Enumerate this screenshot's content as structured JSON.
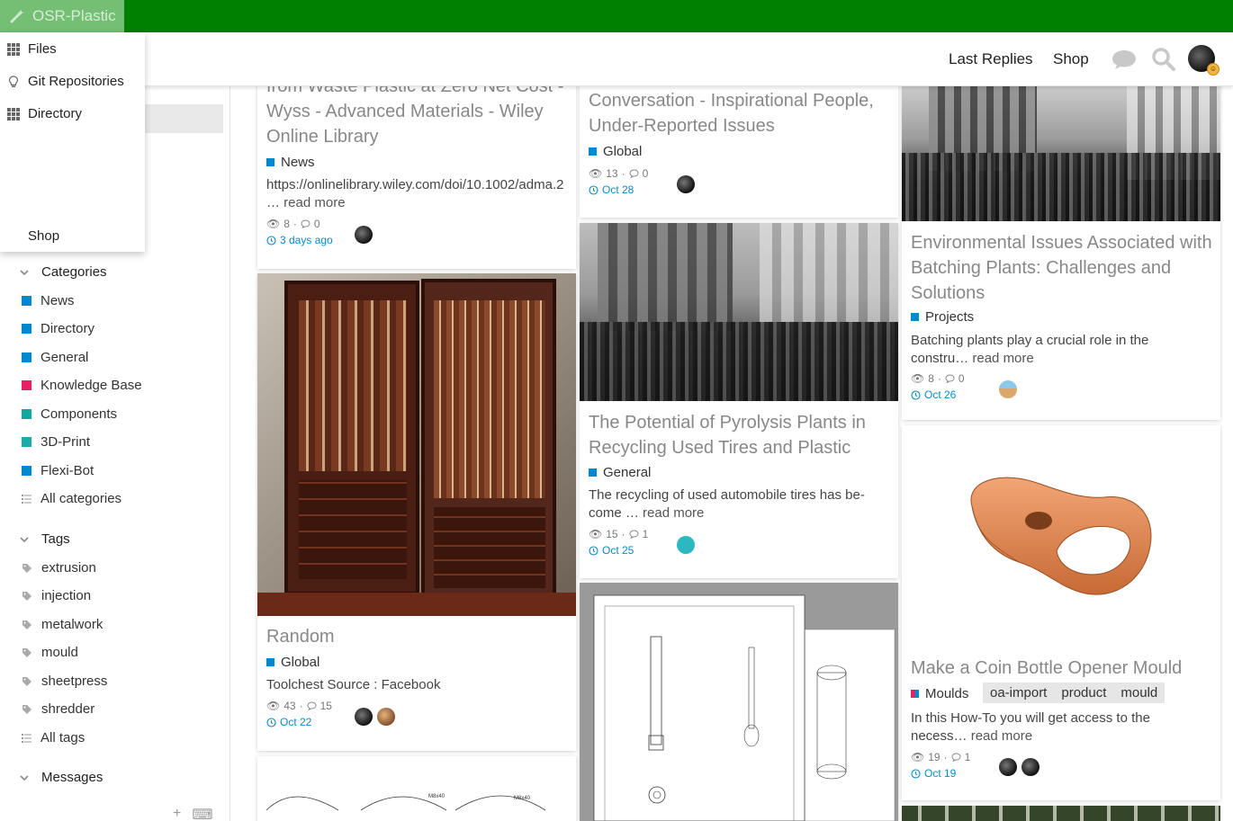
{
  "brand": {
    "name": "OSR-Plastic"
  },
  "header": {
    "last_replies": "Last Replies",
    "shop": "Shop"
  },
  "dropdown": {
    "items": [
      {
        "label": "Files",
        "icon": "grid-icon"
      },
      {
        "label": "Git Repositories",
        "icon": "lightbulb-icon"
      },
      {
        "label": "Directory",
        "icon": "grid-icon"
      },
      {
        "label": "Shop",
        "icon": ""
      }
    ]
  },
  "sidebar": {
    "categories_label": "Categories",
    "categories": [
      {
        "label": "News",
        "color": "#0088cc"
      },
      {
        "label": "Directory",
        "color": "#0088cc"
      },
      {
        "label": "General",
        "color": "#0088cc"
      },
      {
        "label": "Knowledge Base",
        "color": "#e91e63"
      },
      {
        "label": "Components",
        "color": "#12a89d"
      },
      {
        "label": "3D-Print",
        "color": "#1eaaaa"
      },
      {
        "label": "Flexi-Bot",
        "color": "#0088cc"
      },
      {
        "label": "All categories",
        "color": ""
      }
    ],
    "tags_label": "Tags",
    "tags": [
      "extrusion",
      "injection",
      "metalwork",
      "mould",
      "sheetpress",
      "shredder"
    ],
    "all_tags": "All tags",
    "messages_label": "Messages"
  },
  "cards": {
    "c1": {
      "title": "from Waste Plastic at Zero Net Cost - Wyss - Advanced Materials - Wiley Online Library",
      "category": "News",
      "category_color": "#0088cc",
      "excerpt": "https://onlinelibrary.wiley.com/doi/10.1002/adma.2",
      "excerpt2": "…",
      "read_more": "read more",
      "views": "8",
      "replies": "0",
      "date": "3 days ago"
    },
    "c2": {
      "title": "Random",
      "category": "Global",
      "category_color": "#0088cc",
      "excerpt": "Toolchest Source : Facebook",
      "views": "43",
      "replies": "15",
      "date": "Oct 22"
    },
    "c3": {
      "title": "Conversation - Inspirational People, Under-Reported Issues",
      "category": "Global",
      "category_color": "#0088cc",
      "views": "13",
      "replies": "0",
      "date": "Oct 28"
    },
    "c4": {
      "title": "The Potential of Pyrolysis Plants in Recycling Used Tires and Plastic",
      "category": "General",
      "category_color": "#0088cc",
      "excerpt": "The recycling of used automobile tires has be-",
      "excerpt2": "come …",
      "read_more": "read more",
      "views": "15",
      "replies": "1",
      "date": "Oct 25"
    },
    "c5": {
      "title": "Environmental Issues Associated with Batching Plants: Challenges and Solutions",
      "category": "Projects",
      "category_color": "#0088cc",
      "excerpt": "Batching plants play a crucial role in the",
      "excerpt2": "constru…",
      "read_more": "read more",
      "views": "8",
      "replies": "0",
      "date": "Oct 26"
    },
    "c6": {
      "title": "Make a Coin Bottle Opener Mould",
      "category": "Moulds",
      "category_color": "#e91e63",
      "tags": [
        "oa-import",
        "product",
        "mould"
      ],
      "excerpt": "In this How-To you will get access to the",
      "excerpt2": "necess…",
      "read_more": "read more",
      "views": "19",
      "replies": "1",
      "date": "Oct 19"
    }
  }
}
